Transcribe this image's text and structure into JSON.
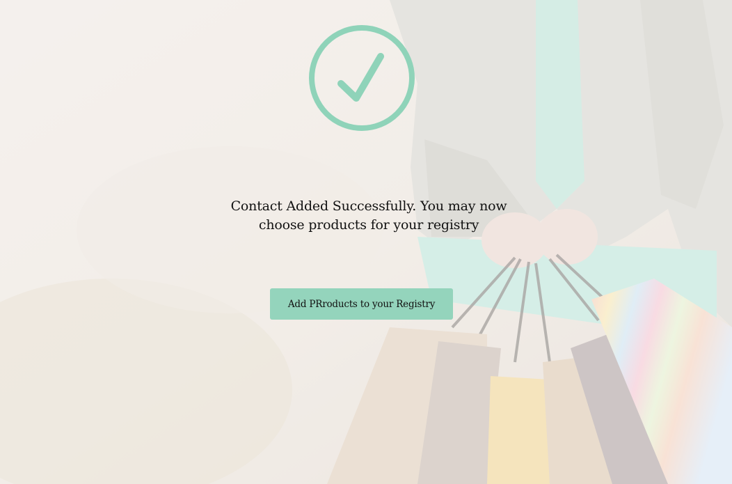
{
  "confirmation": {
    "message": "Contact Added Successfully. You may now choose products for your registry",
    "button_label": "Add PRroducts to your Registry"
  },
  "icons": {
    "status": "check-circle-icon"
  },
  "colors": {
    "accent": "#8fd3b9",
    "text": "#111111"
  }
}
